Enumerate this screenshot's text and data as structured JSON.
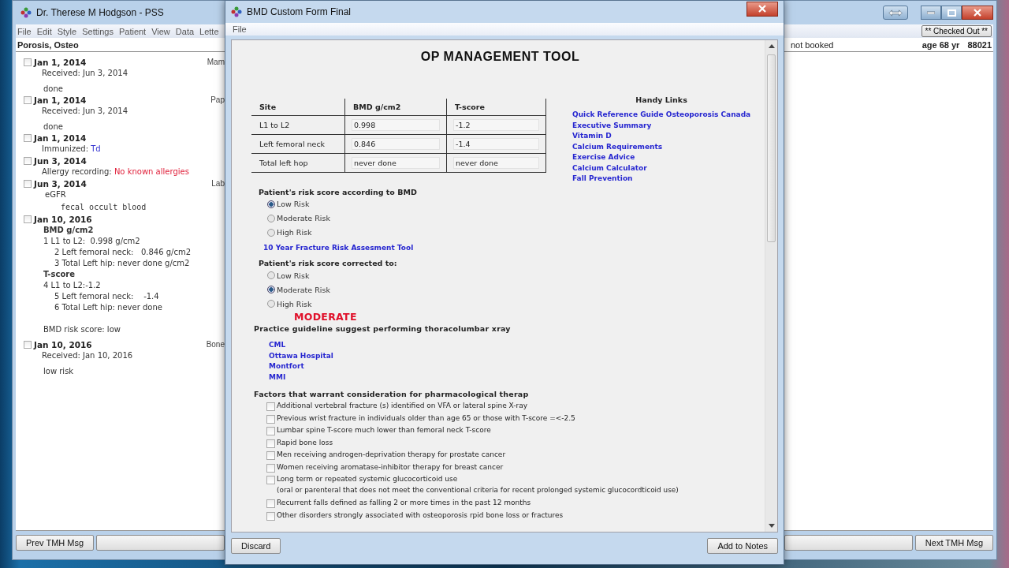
{
  "main_window": {
    "title": "Dr. Therese M Hodgson - PSS",
    "menu": [
      "File",
      "Edit",
      "Style",
      "Settings",
      "Patient",
      "View",
      "Data",
      "Lette"
    ],
    "status_button": "** Checked Out **",
    "patient": {
      "name": "Porosis, Osteo",
      "booking": "not booked",
      "age": "age 68 yr",
      "id": "88021"
    },
    "entries": [
      {
        "date": "Jan 1, 2014",
        "checked": false,
        "tag": "Mam",
        "lines": [
          {
            "kind": "received",
            "text": "Received: Jun 3, 2014"
          },
          {
            "kind": "note",
            "text": "done"
          }
        ]
      },
      {
        "date": "Jan 1, 2014",
        "checked": false,
        "tag": "Pap",
        "lines": [
          {
            "kind": "received",
            "text": "Received: Jun 3, 2014"
          },
          {
            "kind": "note",
            "text": "done"
          }
        ]
      },
      {
        "date": "Jan 1, 2014",
        "checked": false,
        "lines": [
          {
            "kind": "immunized",
            "label": "Immunized:",
            "value": "Td"
          }
        ]
      },
      {
        "date": "Jun 3, 2014",
        "checked": false,
        "lines": [
          {
            "kind": "allergy",
            "label": "Allergy recording:",
            "value": "No known allergies"
          }
        ]
      },
      {
        "date": "Jun 3, 2014",
        "checked": false,
        "tag": "Lab",
        "lines": [
          {
            "kind": "lab",
            "text": "eGFR"
          },
          {
            "kind": "lab-sub",
            "text": "fecal occult blood"
          }
        ]
      },
      {
        "date": "Jan 10, 2016",
        "checked": false,
        "lines": [
          {
            "kind": "heading",
            "text": "BMD g/cm2"
          },
          {
            "kind": "item",
            "text": "1 L1 to L2:  0.998 g/cm2"
          },
          {
            "kind": "subitem",
            "text": "2 Left femoral neck:   0.846 g/cm2"
          },
          {
            "kind": "subitem",
            "text": "3 Total Left hip: never done g/cm2"
          },
          {
            "kind": "heading",
            "text": "T-score"
          },
          {
            "kind": "item",
            "text": "4 L1 to L2:-1.2"
          },
          {
            "kind": "subitem",
            "text": "5 Left femoral neck:    -1.4"
          },
          {
            "kind": "subitem",
            "text": "6 Total Left hip: never done"
          },
          {
            "kind": "score",
            "text": "BMD risk score: low"
          }
        ]
      },
      {
        "date": "Jan 10, 2016",
        "checked": false,
        "tag": "Bone",
        "lines": [
          {
            "kind": "received",
            "text": "Received: Jan 10, 2016"
          },
          {
            "kind": "note",
            "text": "low risk"
          }
        ]
      }
    ],
    "buttons": {
      "prev": "Prev TMH Msg",
      "next": "Next TMH Msg"
    }
  },
  "dialog": {
    "title": "BMD Custom Form Final",
    "menu": [
      "File"
    ],
    "heading": "OP MANAGEMENT TOOL",
    "table": {
      "columns": [
        "Site",
        "BMD g/cm2",
        "T-score"
      ],
      "rows": [
        {
          "site": "L1 to L2",
          "bmd": "0.998",
          "t_score": "-1.2"
        },
        {
          "site": "Left femoral neck",
          "bmd": "0.846",
          "t_score": "-1.4"
        },
        {
          "site": "Total left hop",
          "bmd": "never done",
          "t_score": "never done"
        }
      ]
    },
    "links_title": "Handy Links",
    "links": [
      "Quick Reference Guide Osteoporosis Canada",
      "Executive Summary",
      "Vitamin D",
      "Calcium Requirements",
      "Exercise Advice",
      "Calcium Calculator",
      "Fall Prevention"
    ],
    "bmd_risk": {
      "label": "Patient's risk score according to BMD",
      "options": [
        {
          "label": "Low Risk",
          "selected": true
        },
        {
          "label": "Moderate Risk",
          "selected": false
        },
        {
          "label": "High Risk",
          "selected": false
        }
      ]
    },
    "frax_link": "10 Year Fracture Risk Assesment Tool",
    "corrected_risk": {
      "label": "Patient's risk score corrected to:",
      "options": [
        {
          "label": "Low Risk",
          "selected": false
        },
        {
          "label": "Moderate Risk",
          "selected": true
        },
        {
          "label": "High Risk",
          "selected": false
        }
      ]
    },
    "result": "MODERATE",
    "guideline": "Practice guideline suggest performing thoracolumbar xray",
    "sites": [
      "CML",
      "Ottawa Hospital",
      "Montfort",
      "MMI"
    ],
    "factors_title": "Factors that warrant consideration for pharmacological therap",
    "factors": [
      {
        "label": "Additional vertebral fracture (s) identified on VFA or lateral spine X-ray",
        "checked": false
      },
      {
        "label": "Previous wrist fracture in individuals older than age 65 or those with T-score =<-2.5",
        "checked": false
      },
      {
        "label": "Lumbar spine T-score much lower than femoral neck T-score",
        "checked": false
      },
      {
        "label": "Rapid bone loss",
        "checked": false
      },
      {
        "label": "Men receiving androgen-deprivation therapy for prostate cancer",
        "checked": false
      },
      {
        "label": "Women receiving aromatase-inhibitor therapy for breast cancer",
        "checked": false
      },
      {
        "label": "Long term or repeated systemic glucocorticoid use",
        "note": "(oral or parenteral that does not meet the conventional criteria for recent prolonged systemic glucocordticoid use)",
        "checked": false
      },
      {
        "label": "Recurrent falls defined as falling 2 or more times in the past 12 months",
        "checked": false
      },
      {
        "label": "Other disorders strongly associated with osteoporosis rpid bone loss or fractures",
        "checked": false
      }
    ],
    "buttons": {
      "discard": "Discard",
      "add": "Add to Notes"
    }
  }
}
